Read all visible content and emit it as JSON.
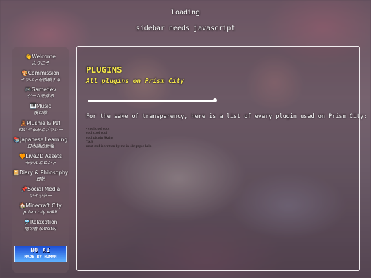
{
  "status": {
    "loading": "loading",
    "sidebar_message": "sidebar needs javascript"
  },
  "sidebar": {
    "items": [
      {
        "label": "👋Welcome",
        "sub": "ようこそ"
      },
      {
        "label": "🎨Commission",
        "sub": "イラストを依頼する"
      },
      {
        "label": "🎮Gamedev",
        "sub": "ゲームを作る"
      },
      {
        "label": "🎹Music",
        "sub": "僕の歌"
      },
      {
        "label": "🧸Plushie & Pet",
        "sub": "ぬいぐるみとブラシー"
      },
      {
        "label": "📚Japanese Learning",
        "sub": "日本語の勉強"
      },
      {
        "label": "🧡Live2D Assets",
        "sub": "モデルとヒント"
      },
      {
        "label": "📔Diary & Philosophy",
        "sub": "日記"
      },
      {
        "label": "📌Social Media",
        "sub": "ツイッター"
      },
      {
        "label": "🏠Minecraft City",
        "sub": "prism city wiki!"
      },
      {
        "label": "🎐Relaxation",
        "sub": "雨の音 (offsite)"
      }
    ],
    "badge": {
      "line1": "NO AI",
      "line2": "MADE BY HUMAN"
    }
  },
  "main": {
    "title": "PLUGINS",
    "subtitle": "All plugins on Prism City",
    "intro": "For the sake of transparency, here is a list of every plugin used on Prism City:",
    "plugins": [
      "•     cool cool cool",
      "cool cool cool",
      "cool plugin Skript",
      "TAB",
      "most stuf is written by me in skript pls help"
    ]
  },
  "colors": {
    "heading": "#f4e64a",
    "panel_border": "#f2eef0",
    "badge_bg": "#1d4fd6"
  }
}
